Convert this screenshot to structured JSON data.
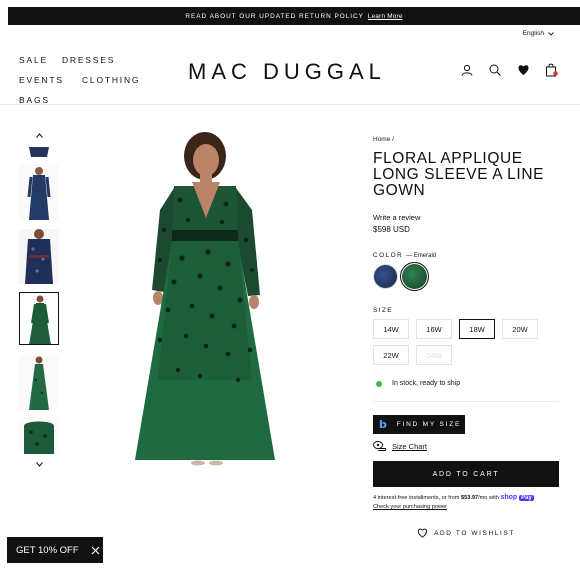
{
  "announcement": {
    "text": "READ ABOUT OUR UPDATED RETURN POLICY",
    "link": "Learn More"
  },
  "language": {
    "selected": "English"
  },
  "nav": {
    "items": [
      "SALE",
      "DRESSES",
      "EVENTS",
      "CLOTHING",
      "BAGS"
    ]
  },
  "brand": {
    "logo": "MAC DUGGAL"
  },
  "header_icons": [
    "user-icon",
    "search-icon",
    "heart-icon",
    "bag-icon"
  ],
  "product": {
    "breadcrumb": "Home /",
    "title": "FLORAL APPLIQUE LONG SLEEVE A LINE GOWN",
    "review_link": "Write a review",
    "price": "$598 USD",
    "color_label": "COLOR",
    "color_selected": "— Emerald",
    "colors": [
      {
        "name": "Navy",
        "hex": "#1f2f55"
      },
      {
        "name": "Emerald",
        "hex": "#1d5a3a"
      }
    ],
    "size_label": "SIZE",
    "sizes": [
      {
        "label": "14W",
        "state": "available"
      },
      {
        "label": "16W",
        "state": "available"
      },
      {
        "label": "18W",
        "state": "selected"
      },
      {
        "label": "20W",
        "state": "available"
      },
      {
        "label": "22W",
        "state": "available"
      },
      {
        "label": "24W",
        "state": "unavailable"
      }
    ],
    "stock": "In stock, ready to ship",
    "find_my_size": "FIND MY SIZE",
    "size_chart": "Size Chart",
    "add_to_cart": "ADD TO CART",
    "installments": {
      "prefix": "4 interest-free installments, or from",
      "amount": "$53.97",
      "suffix": "/mo with",
      "brand_shop": "shop",
      "brand_pay": "Pay",
      "link": "Check your purchasing power"
    },
    "wishlist": "ADD TO WISHLIST"
  },
  "promo": {
    "text": "GET 10% OFF"
  },
  "colors_ui": {
    "accent_dark": "#111111",
    "in_stock": "#35c04a",
    "shop_pay": "#5a31f4",
    "emerald": "#1d5a3a"
  }
}
